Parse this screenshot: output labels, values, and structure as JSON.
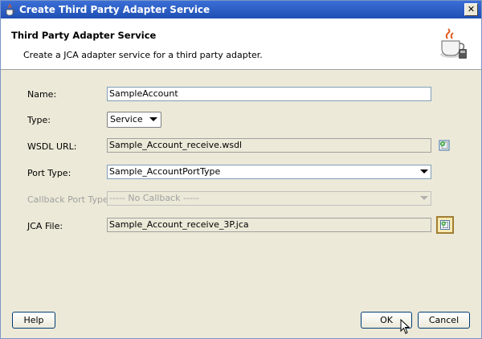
{
  "window": {
    "title": "Create Third Party Adapter Service"
  },
  "header": {
    "title": "Third Party Adapter Service",
    "description": "Create a JCA adapter service for a third party adapter."
  },
  "form": {
    "name_label": "Name:",
    "name_value": "SampleAccount",
    "type_label": "Type:",
    "type_value": "Service",
    "wsdl_label": "WSDL URL:",
    "wsdl_value": "Sample_Account_receive.wsdl",
    "port_label": "Port Type:",
    "port_value": "Sample_AccountPortType",
    "callback_label": "Callback Port Type:",
    "callback_value": "----- No Callback -----",
    "jca_label": "JCA File:",
    "jca_value": "Sample_Account_receive_3P.jca"
  },
  "buttons": {
    "help": "Help",
    "ok": "OK",
    "cancel": "Cancel"
  },
  "icons": {
    "title": "java-cup-icon",
    "header": "adapter-cup-icon",
    "browse": "browse-icon",
    "close": "close-icon",
    "cursor": "mouse-pointer-icon"
  },
  "colors": {
    "titlebar": "#1f4fb3",
    "dialog_bg": "#ece9d8",
    "header_bg": "#ffffff"
  }
}
